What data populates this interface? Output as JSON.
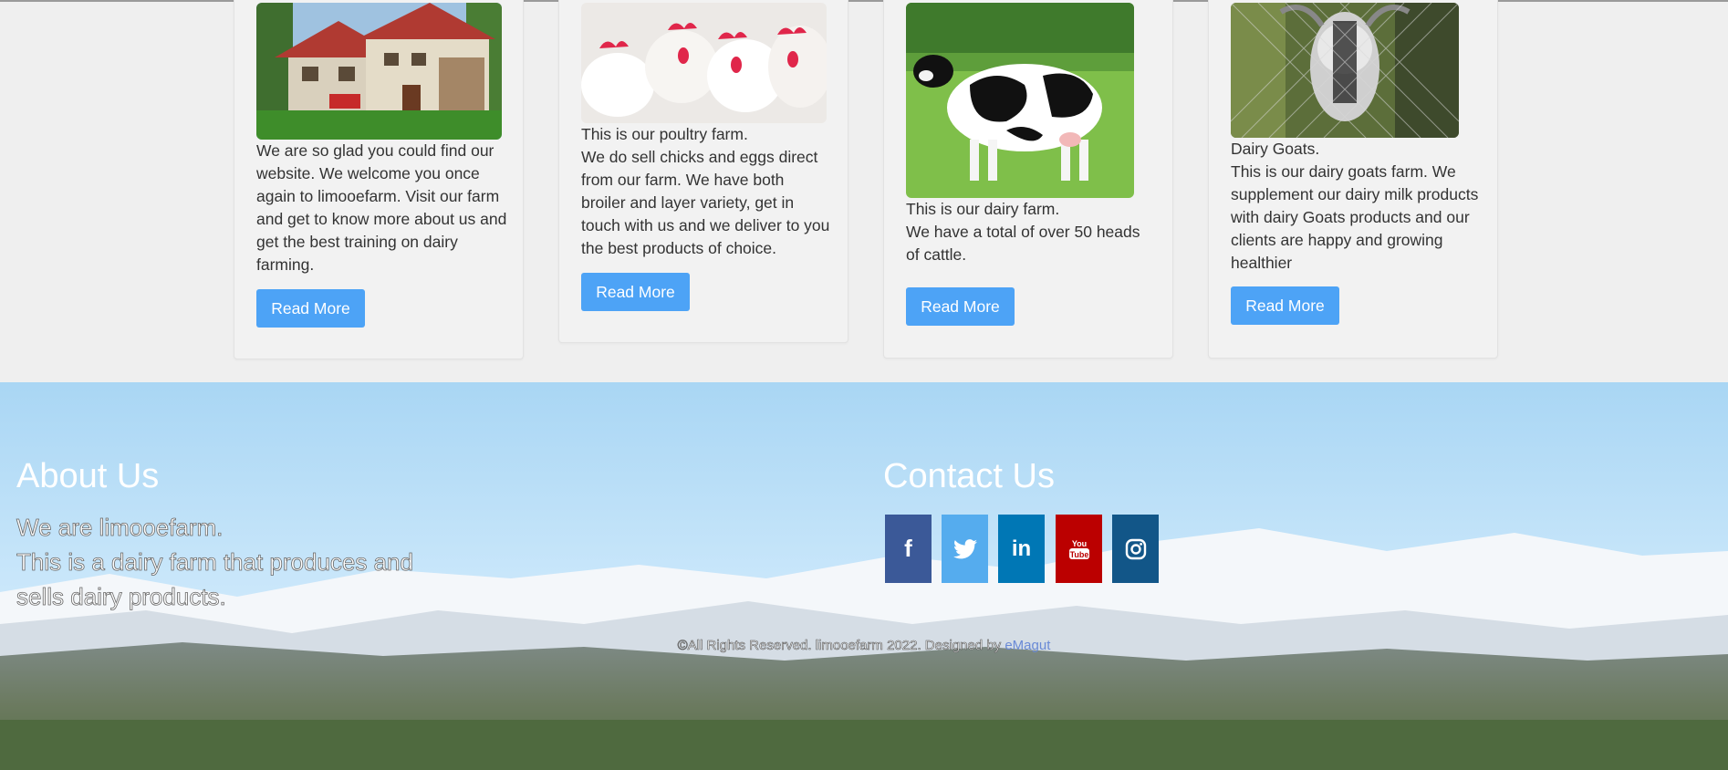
{
  "cards": [
    {
      "image": "farm-house-photo",
      "paragraphs": [
        "We are so glad you could find our website. We welcome you once again to limooefarm. Visit our farm and get to know more about us and get the best training on dairy farming."
      ],
      "button_label": "Read More"
    },
    {
      "image": "poultry-chickens-photo",
      "paragraphs": [
        "This is our poultry farm.",
        "We do sell chicks and eggs direct from our farm. We have both broiler and layer variety, get in touch with us and we deliver to you the best products of choice."
      ],
      "button_label": "Read More"
    },
    {
      "image": "dairy-cow-photo",
      "paragraphs": [
        "This is our dairy farm.",
        "We have a total of over 50 heads of cattle."
      ],
      "button_label": "Read More"
    },
    {
      "image": "dairy-goat-photo",
      "paragraphs": [
        "Dairy Goats.",
        "This is our dairy goats farm. We supplement our dairy milk products with dairy Goats products and our clients are happy and growing healthier"
      ],
      "button_label": "Read More"
    }
  ],
  "footer": {
    "about_title": "About Us",
    "about_lines": [
      "We are limooefarm.",
      "This is a dairy farm that produces and sells dairy products."
    ],
    "contact_title": "Contact Us",
    "social": [
      {
        "name": "facebook-icon",
        "glyph": "f",
        "color": "#3b5998"
      },
      {
        "name": "twitter-icon",
        "glyph": "t",
        "color": "#55acee"
      },
      {
        "name": "linkedin-icon",
        "glyph": "in",
        "color": "#0077b5"
      },
      {
        "name": "youtube-icon",
        "glyph": "You Tube",
        "color": "#bb0000"
      },
      {
        "name": "instagram-icon",
        "glyph": "ig",
        "color": "#125688"
      }
    ],
    "copyright_text": "©All Rights Reserved. limooefarm 2022. Designed by ",
    "designer_link": "eMagut"
  },
  "colors": {
    "button": "#4da3f6",
    "card_bg": "#f2f2f2",
    "page_bg": "#efefef"
  }
}
